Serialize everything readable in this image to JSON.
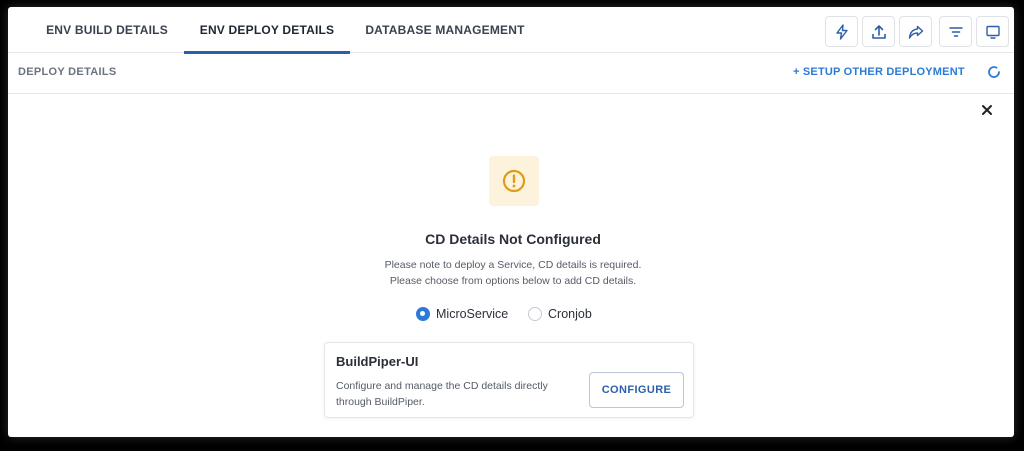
{
  "tabs": [
    {
      "label": "ENV BUILD DETAILS",
      "active": false
    },
    {
      "label": "ENV DEPLOY DETAILS",
      "active": true
    },
    {
      "label": "DATABASE MANAGEMENT",
      "active": false
    }
  ],
  "toolbar": {
    "icons": [
      "lightning-icon",
      "upload-icon",
      "share-icon",
      "filter-icon",
      "monitor-icon"
    ]
  },
  "subheader": {
    "crumb": "DEPLOY DETAILS",
    "setup_link": "+ SETUP OTHER DEPLOYMENT"
  },
  "empty_state": {
    "title": "CD Details Not Configured",
    "line1": "Please note to deploy a Service, CD details is required.",
    "line2": "Please choose from options below to add CD details.",
    "options": [
      {
        "label": "MicroService",
        "selected": true
      },
      {
        "label": "Cronjob",
        "selected": false
      }
    ]
  },
  "card": {
    "title": "BuildPiper-UI",
    "description": "Configure and manage the CD details directly through BuildPiper.",
    "button_label": "CONFIGURE"
  },
  "colors": {
    "accent": "#2b5fad",
    "link": "#2b7bd6",
    "warning": "#e09b1c",
    "warning_bg": "#fdf3dc"
  }
}
